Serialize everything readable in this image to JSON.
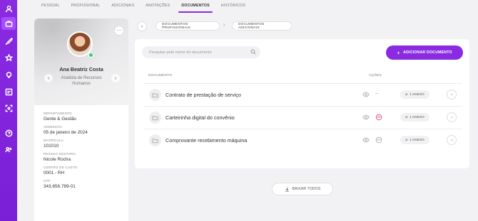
{
  "tabs": [
    {
      "label": "Pessoal"
    },
    {
      "label": "Profissional"
    },
    {
      "label": "Adicionais"
    },
    {
      "label": "Anotações"
    },
    {
      "label": "Documentos"
    },
    {
      "label": "Históricos"
    }
  ],
  "active_tab": "Documentos",
  "sidebar_icons": [
    "user-icon",
    "briefcase-icon",
    "rocket-icon",
    "star-icon",
    "lightbulb-icon",
    "id-card-icon",
    "scan-icon",
    "help-icon",
    "team-icon"
  ],
  "profile": {
    "name": "Ana Beatriz Costa",
    "role": "Analista de Recursos Humanos",
    "status_color": "#2ecc71",
    "fields": [
      {
        "label": "Departamento",
        "value": "Gente & Gestão"
      },
      {
        "label": "Admissão",
        "value": "05 de janeiro de 2024"
      },
      {
        "label": "Matrícula",
        "value": "101010"
      },
      {
        "label": "Pessoa gestora",
        "value": "Nicole Rocha"
      },
      {
        "label": "Centro de custo",
        "value": "0001 - RH"
      },
      {
        "label": "CPF",
        "value": "343.656.789-01"
      }
    ]
  },
  "breadcrumb": {
    "items": [
      "Documentos profissionais",
      "Documentos adicionais"
    ]
  },
  "documents": {
    "search_placeholder": "Pesquise pelo nome do documento",
    "add_button": "Adicionar documento",
    "col_document": "Documento",
    "col_actions": "Ações",
    "rows": [
      {
        "name": "Contrato de prestação de serviço",
        "attachments": "1 anexo",
        "signature_state": "none"
      },
      {
        "name": "Carteirinha digital do convênio",
        "attachments": "1 anexo",
        "signature_state": "active"
      },
      {
        "name": "Comprovante recebimento máquina",
        "attachments": "1 anexo",
        "signature_state": "inactive"
      }
    ],
    "download_all": "Baixar todos"
  },
  "colors": {
    "primary": "#8a2be2",
    "signature_active": "#e0457b"
  }
}
